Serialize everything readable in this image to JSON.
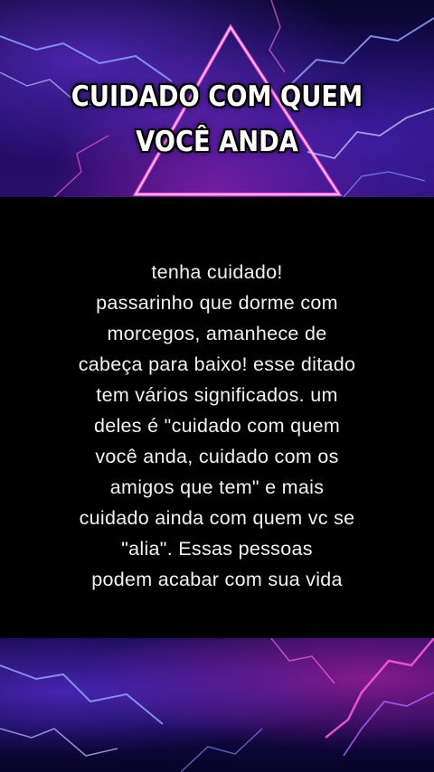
{
  "headline": {
    "line1": "CUIDADO COM QUEM",
    "line2": "VOCÊ ANDA"
  },
  "body": {
    "lines": [
      "tenha cuidado!",
      "passarinho que dorme com",
      "morcegos, amanhece de",
      "cabeça para baixo! esse ditado",
      "tem vários significados. um",
      "deles é \"cuidado com quem",
      "você anda, cuidado com os",
      "amigos que tem\" e mais",
      "cuidado ainda com quem vc se",
      "\"alia\". Essas pessoas",
      "podem acabar com sua vida"
    ]
  },
  "colors": {
    "lightning_blue": "#6a7dff",
    "lightning_pink": "#ff3fd8",
    "panel": "#000000",
    "text": "#ffffff"
  }
}
